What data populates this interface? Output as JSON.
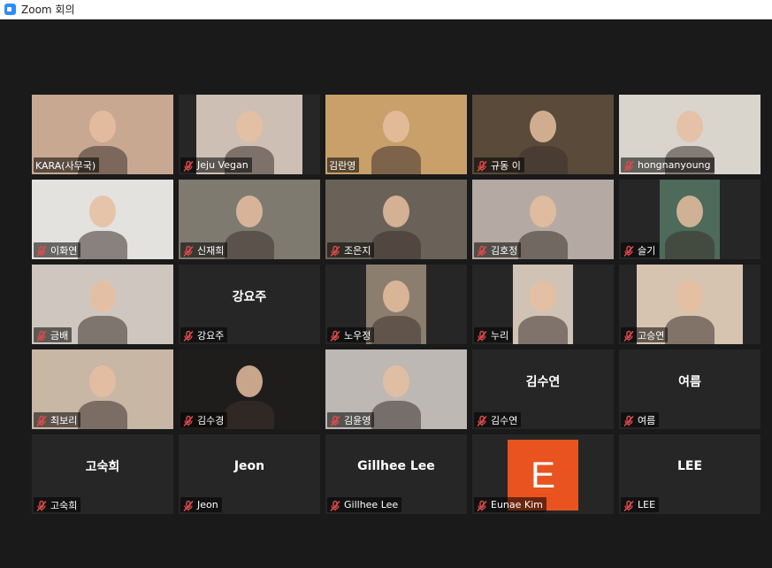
{
  "window": {
    "title": "Zoom 회의"
  },
  "colors": {
    "active_speaker_border": "#c9e04c",
    "avatar_e": "#e8531f"
  },
  "participants": [
    {
      "name": "KARA(사무국)",
      "muted": false,
      "video": true,
      "bg": "#c9a891"
    },
    {
      "name": "Jeju Vegan",
      "muted": true,
      "video": true,
      "bg": "#cdbfb3"
    },
    {
      "name": "김란영",
      "muted": false,
      "video": true,
      "bg": "#c9a06a",
      "active": true
    },
    {
      "name": "규동 이",
      "muted": true,
      "video": true,
      "bg": "#5a4a3a"
    },
    {
      "name": "hongnanyoung",
      "muted": true,
      "video": true,
      "bg": "#d9d5cd"
    },
    {
      "name": "이화연",
      "muted": true,
      "video": true,
      "bg": "#e4e2df"
    },
    {
      "name": "신재희",
      "muted": true,
      "video": true,
      "bg": "#7e7a70"
    },
    {
      "name": "조은지",
      "muted": true,
      "video": true,
      "bg": "#6a6258"
    },
    {
      "name": "김호정",
      "muted": true,
      "video": true,
      "bg": "#b4aaa3"
    },
    {
      "name": "슬기",
      "muted": true,
      "video": true,
      "bg": "#4d6a5a"
    },
    {
      "name": "금배",
      "muted": true,
      "video": true,
      "bg": "#cfc7bf"
    },
    {
      "name": "강요주",
      "muted": true,
      "video": false
    },
    {
      "name": "노우정",
      "muted": true,
      "video": true,
      "bg": "#8c7e6f"
    },
    {
      "name": "누리",
      "muted": true,
      "video": true,
      "bg": "#d0c3b5"
    },
    {
      "name": "고승연",
      "muted": true,
      "video": true,
      "bg": "#d7c4b0"
    },
    {
      "name": "최보리",
      "muted": true,
      "video": true,
      "bg": "#c9b7a6"
    },
    {
      "name": "김수경",
      "muted": true,
      "video": true,
      "bg": "#1f1d1c"
    },
    {
      "name": "김윤영",
      "muted": true,
      "video": true,
      "bg": "#bdb8b3"
    },
    {
      "name": "김수연",
      "muted": true,
      "video": false
    },
    {
      "name": "여름",
      "muted": true,
      "video": false
    },
    {
      "name": "고숙희",
      "muted": true,
      "video": false
    },
    {
      "name": "Jeon",
      "muted": true,
      "video": false
    },
    {
      "name": "Gillhee Lee",
      "muted": true,
      "video": false
    },
    {
      "name": "Eunae Kim",
      "muted": true,
      "video": false,
      "avatar_letter": "E"
    },
    {
      "name": "LEE",
      "muted": true,
      "video": false
    }
  ]
}
